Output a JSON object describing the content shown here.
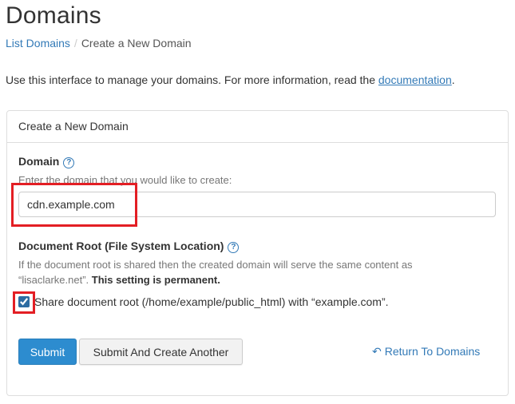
{
  "page": {
    "title": "Domains",
    "intro_text": "Use this interface to manage your domains. For more information, read the ",
    "intro_link": "documentation",
    "intro_end": "."
  },
  "breadcrumb": {
    "parent": "List Domains",
    "separator": "/",
    "current": "Create a New Domain"
  },
  "panel": {
    "heading": "Create a New Domain"
  },
  "domain_field": {
    "label": "Domain",
    "help_icon": "question-circle-icon",
    "hint": "Enter the domain that you would like to create:",
    "value": "cdn.example.com"
  },
  "docroot": {
    "label": "Document Root (File System Location)",
    "help_icon": "question-circle-icon",
    "description": "If the document root is shared then the created domain will serve the same content as “lisaclarke.net”.",
    "permanent": "This setting is permanent.",
    "checkbox_label": "Share document root (/home/example/public_html) with “example.com”.",
    "checked": true
  },
  "actions": {
    "submit": "Submit",
    "submit_another": "Submit And Create Another",
    "return": "Return To Domains",
    "return_icon": "undo-arrow-icon"
  },
  "colors": {
    "primary": "#2d8ccf",
    "link": "#337ab7",
    "highlight": "#e31e24"
  }
}
